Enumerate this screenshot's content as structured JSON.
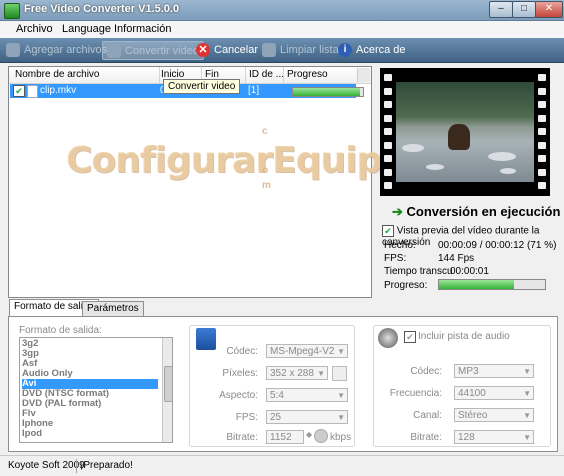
{
  "window": {
    "title": "Free Video Converter V1.5.0.0"
  },
  "menu": [
    "Archivo",
    "Language",
    "Información"
  ],
  "toolbar": {
    "add_files": "Agregar archivos",
    "convert": "Convertir video",
    "cancel": "Cancelar",
    "clear_list": "Limpiar lista",
    "about": "Acerca de"
  },
  "filelist": {
    "columns": [
      "Nombre de archivo",
      "Inicio",
      "Fin",
      "ID de ...",
      "Progreso"
    ],
    "rows": [
      {
        "name": "clip.mkv",
        "start": "0",
        "id": "[1]",
        "checked": true,
        "progress": 0.95
      }
    ],
    "tooltip": "Convertir video"
  },
  "watermark": "ConfigurarEquipos",
  "watermark_small": [
    "c",
    "o",
    "m"
  ],
  "status": {
    "title": "Conversión en ejecución",
    "preview_label": "Vista previa del vídeo durante la conversión",
    "preview_checked": true,
    "done_label": "Hecho:",
    "done_value": "00:00:09 / 00:00:12  (71 %)",
    "fps_label": "FPS:",
    "fps_value": "144 Fps",
    "time_label": "Tiempo transcu",
    "time_value": "00:00:01",
    "progress_label": "Progreso:",
    "progress": 0.71
  },
  "tabs": [
    "Formato de salida",
    "Parámetros"
  ],
  "output": {
    "label": "Formato de salida:",
    "formats": [
      "3g2",
      "3gp",
      "Asf",
      "Audio Only",
      "Avi",
      "DVD (NTSC format)",
      "DVD (PAL format)",
      "Flv",
      "Iphone",
      "Ipod"
    ],
    "selected_index": 4
  },
  "video": {
    "codec_label": "Códec:",
    "codec": "MS-Mpeg4-V2",
    "pixels_label": "Píxeles:",
    "pixels": "352 x 288",
    "aspect_label": "Aspecto:",
    "aspect": "5:4",
    "fps_label": "FPS:",
    "fps": "25",
    "bitrate_label": "Bitrate:",
    "bitrate": "1152",
    "bitrate_unit": "kbps"
  },
  "audio": {
    "include_label": "Incluir pista de audio",
    "codec_label": "Códec:",
    "codec": "MP3",
    "freq_label": "Frecuencia:",
    "freq": "44100",
    "channel_label": "Canal:",
    "channel": "Stéreo",
    "bitrate_label": "Bitrate:",
    "bitrate": "128"
  },
  "statusbar": {
    "company": "Koyote Soft 2009",
    "message": "¡Preparado!"
  }
}
